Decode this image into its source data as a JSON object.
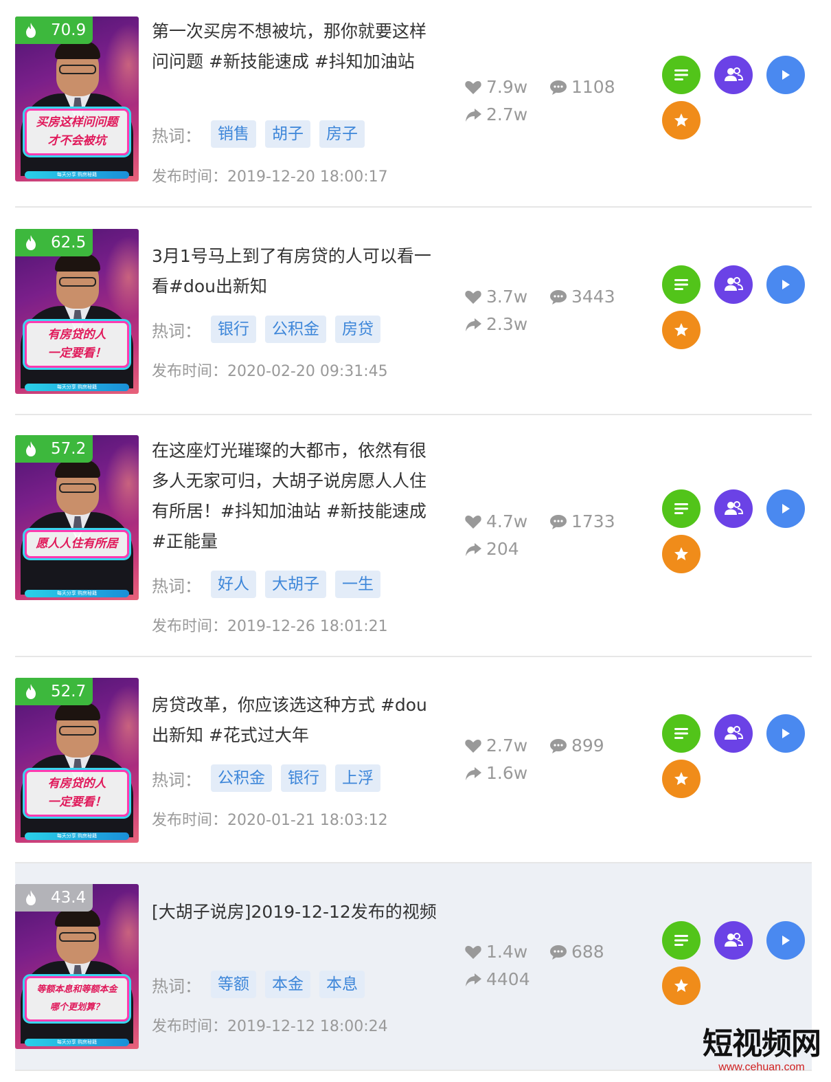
{
  "labels": {
    "hot_words": "热词：",
    "publish_time": "发布时间："
  },
  "items": [
    {
      "score": "70.9",
      "caption_lines": [
        "买房这样问问题",
        "才不会被坑"
      ],
      "strip_text": "每天分享 购房秘籍",
      "title": "第一次买房不想被坑，那你就要这样问问题 #新技能速成 #抖知加油站",
      "tags": [
        "销售",
        "胡子",
        "房子"
      ],
      "time": "2019-12-20 18:00:17",
      "likes": "7.9w",
      "comments": "1108",
      "shares": "2.7w"
    },
    {
      "score": "62.5",
      "caption_lines": [
        "有房贷的人",
        "一定要看！"
      ],
      "strip_text": "每天分享 购房秘籍",
      "title": "3月1号马上到了有房贷的人可以看一看#dou出新知",
      "tags": [
        "银行",
        "公积金",
        "房贷"
      ],
      "time": "2020-02-20 09:31:45",
      "likes": "3.7w",
      "comments": "3443",
      "shares": "2.3w"
    },
    {
      "score": "57.2",
      "caption_lines": [
        "愿人人住有所居"
      ],
      "strip_text": "每天分享 购房秘籍",
      "title": "在这座灯光璀璨的大都市，依然有很多人无家可归，大胡子说房愿人人住有所居！#抖知加油站 #新技能速成 #正能量",
      "tags": [
        "好人",
        "大胡子",
        "一生"
      ],
      "time": "2019-12-26 18:01:21",
      "likes": "4.7w",
      "comments": "1733",
      "shares": "204"
    },
    {
      "score": "52.7",
      "caption_lines": [
        "有房贷的人",
        "一定要看！"
      ],
      "strip_text": "每天分享 购房秘籍",
      "title": "房贷改革，你应该选这种方式 #dou出新知 #花式过大年",
      "tags": [
        "公积金",
        "银行",
        "上浮"
      ],
      "time": "2020-01-21 18:03:12",
      "likes": "2.7w",
      "comments": "899",
      "shares": "1.6w"
    },
    {
      "score": "43.4",
      "caption_lines": [
        "等额本息和等额本金",
        "哪个更划算？"
      ],
      "strip_text": "每天分享 购房秘籍",
      "title": "[大胡子说房]2019-12-12发布的视频",
      "tags": [
        "等额",
        "本金",
        "本息"
      ],
      "time": "2019-12-12 18:00:24",
      "likes": "1.4w",
      "comments": "688",
      "shares": "4404"
    }
  ],
  "watermark": {
    "line1": "短视频网",
    "line2": "www.cehuan.com"
  }
}
